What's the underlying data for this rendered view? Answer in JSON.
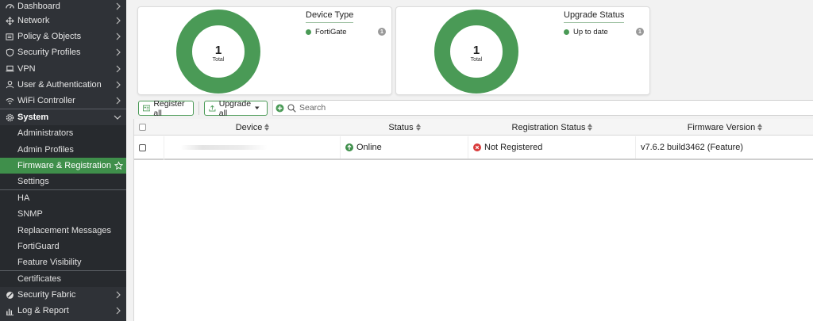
{
  "sidebar": {
    "items": [
      {
        "label": "Dashboard",
        "icon": "dashboard-icon"
      },
      {
        "label": "Network",
        "icon": "network-icon"
      },
      {
        "label": "Policy & Objects",
        "icon": "policy-icon"
      },
      {
        "label": "Security Profiles",
        "icon": "shield-icon"
      },
      {
        "label": "VPN",
        "icon": "laptop-icon"
      },
      {
        "label": "User & Authentication",
        "icon": "user-icon"
      },
      {
        "label": "WiFi Controller",
        "icon": "wifi-icon"
      },
      {
        "label": "System",
        "icon": "gear-icon"
      }
    ],
    "system_sub": [
      "Administrators",
      "Admin Profiles",
      "Firmware & Registration",
      "Settings",
      "HA",
      "SNMP",
      "Replacement Messages",
      "FortiGuard",
      "Feature Visibility",
      "Certificates"
    ],
    "bottom_items": [
      {
        "label": "Security Fabric",
        "icon": "fabric-icon"
      },
      {
        "label": "Log & Report",
        "icon": "report-icon"
      }
    ]
  },
  "widgets": {
    "device_type": {
      "title": "Device Type",
      "total_value": "1",
      "total_label": "Total",
      "legend_label": "FortiGate",
      "legend_count": "1"
    },
    "upgrade_status": {
      "title": "Upgrade Status",
      "total_value": "1",
      "total_label": "Total",
      "legend_label": "Up to date",
      "legend_count": "1"
    }
  },
  "toolbar": {
    "register_label": "Register all",
    "upgrade_label": "Upgrade all",
    "search_placeholder": "Search"
  },
  "table": {
    "columns": [
      "Device",
      "Status",
      "Registration Status",
      "Firmware Version"
    ],
    "rows": [
      {
        "device": "",
        "status": "Online",
        "registration": "Not Registered",
        "firmware": "v7.6.2 build3462 (Feature)"
      }
    ]
  },
  "colors": {
    "accent": "#3f8f4b",
    "donut": "#4a9a56",
    "sidebar_bg": "#2f3237",
    "error": "#d93b3b"
  }
}
